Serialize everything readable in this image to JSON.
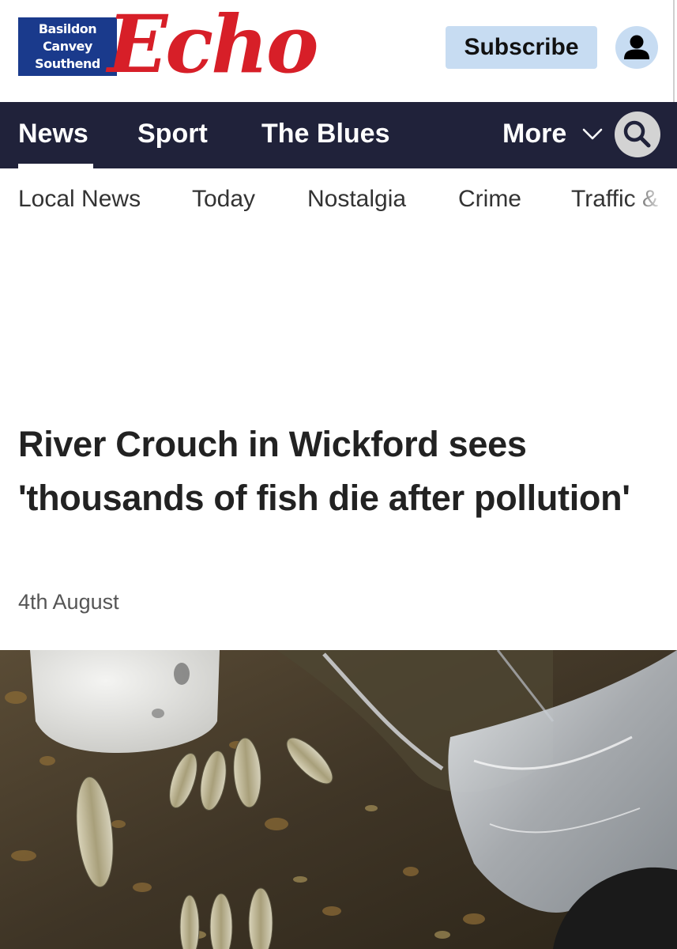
{
  "masthead": {
    "logo_line1": "Basildon",
    "logo_line2": "Canvey",
    "logo_line3": "Southend",
    "logo_word": "Echo",
    "subscribe_label": "Subscribe",
    "account_icon": "person-icon"
  },
  "main_nav": {
    "items": [
      {
        "label": "News",
        "active": true
      },
      {
        "label": "Sport",
        "active": false
      },
      {
        "label": "The Blues",
        "active": false
      }
    ],
    "more_label": "More",
    "more_icon": "chevron-down-icon",
    "search_icon": "search-icon"
  },
  "sub_nav": {
    "items": [
      "Local News",
      "Today",
      "Nostalgia",
      "Crime",
      "Traffic & Travel"
    ]
  },
  "article": {
    "headline": "River Crouch in Wickford sees 'thousands of fish die after pollution'",
    "date": "4th August"
  },
  "colors": {
    "brand_red": "#d71f28",
    "brand_blue": "#1a3a8c",
    "nav_bg": "#20223a",
    "subscribe_bg": "#c7dcf2"
  }
}
